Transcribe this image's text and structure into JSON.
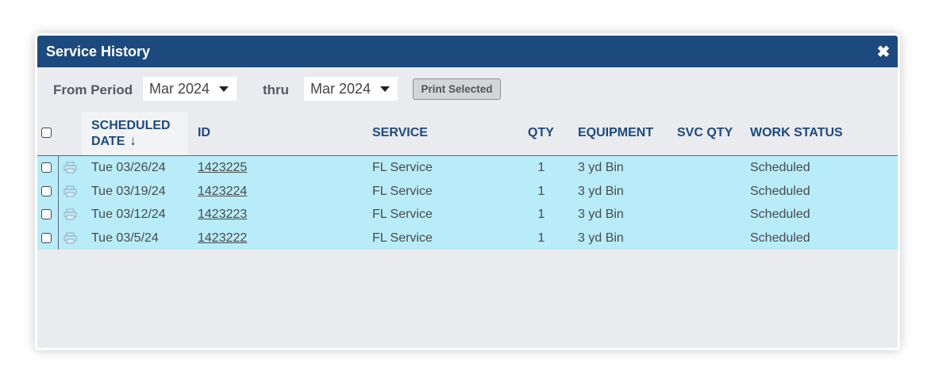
{
  "dialog": {
    "title": "Service History",
    "close_icon": "close-icon"
  },
  "filters": {
    "from_label": "From Period",
    "from_value": "Mar 2024",
    "thru_label": "thru",
    "thru_value": "Mar 2024",
    "print_label": "Print Selected"
  },
  "table": {
    "headers": {
      "scheduled_line1": "SCHEDULED",
      "scheduled_line2": "DATE",
      "sort_arrow": "↓",
      "id": "ID",
      "service": "SERVICE",
      "qty": "QTY",
      "equipment": "EQUIPMENT",
      "svc_qty": "SVC QTY",
      "work_status": "WORK STATUS"
    },
    "rows": [
      {
        "date": "Tue 03/26/24",
        "id": "1423225",
        "service": "FL Service",
        "qty": "1",
        "equipment": "3 yd Bin",
        "svc_qty": "",
        "status": "Scheduled"
      },
      {
        "date": "Tue 03/19/24",
        "id": "1423224",
        "service": "FL Service",
        "qty": "1",
        "equipment": "3 yd Bin",
        "svc_qty": "",
        "status": "Scheduled"
      },
      {
        "date": "Tue 03/12/24",
        "id": "1423223",
        "service": "FL Service",
        "qty": "1",
        "equipment": "3 yd Bin",
        "svc_qty": "",
        "status": "Scheduled"
      },
      {
        "date": "Tue 03/5/24",
        "id": "1423222",
        "service": "FL Service",
        "qty": "1",
        "equipment": "3 yd Bin",
        "svc_qty": "",
        "status": "Scheduled"
      }
    ]
  },
  "colors": {
    "header_bg": "#1c4a7e",
    "row_highlight": "#b8ecf9",
    "panel_bg": "#e9ebef"
  }
}
